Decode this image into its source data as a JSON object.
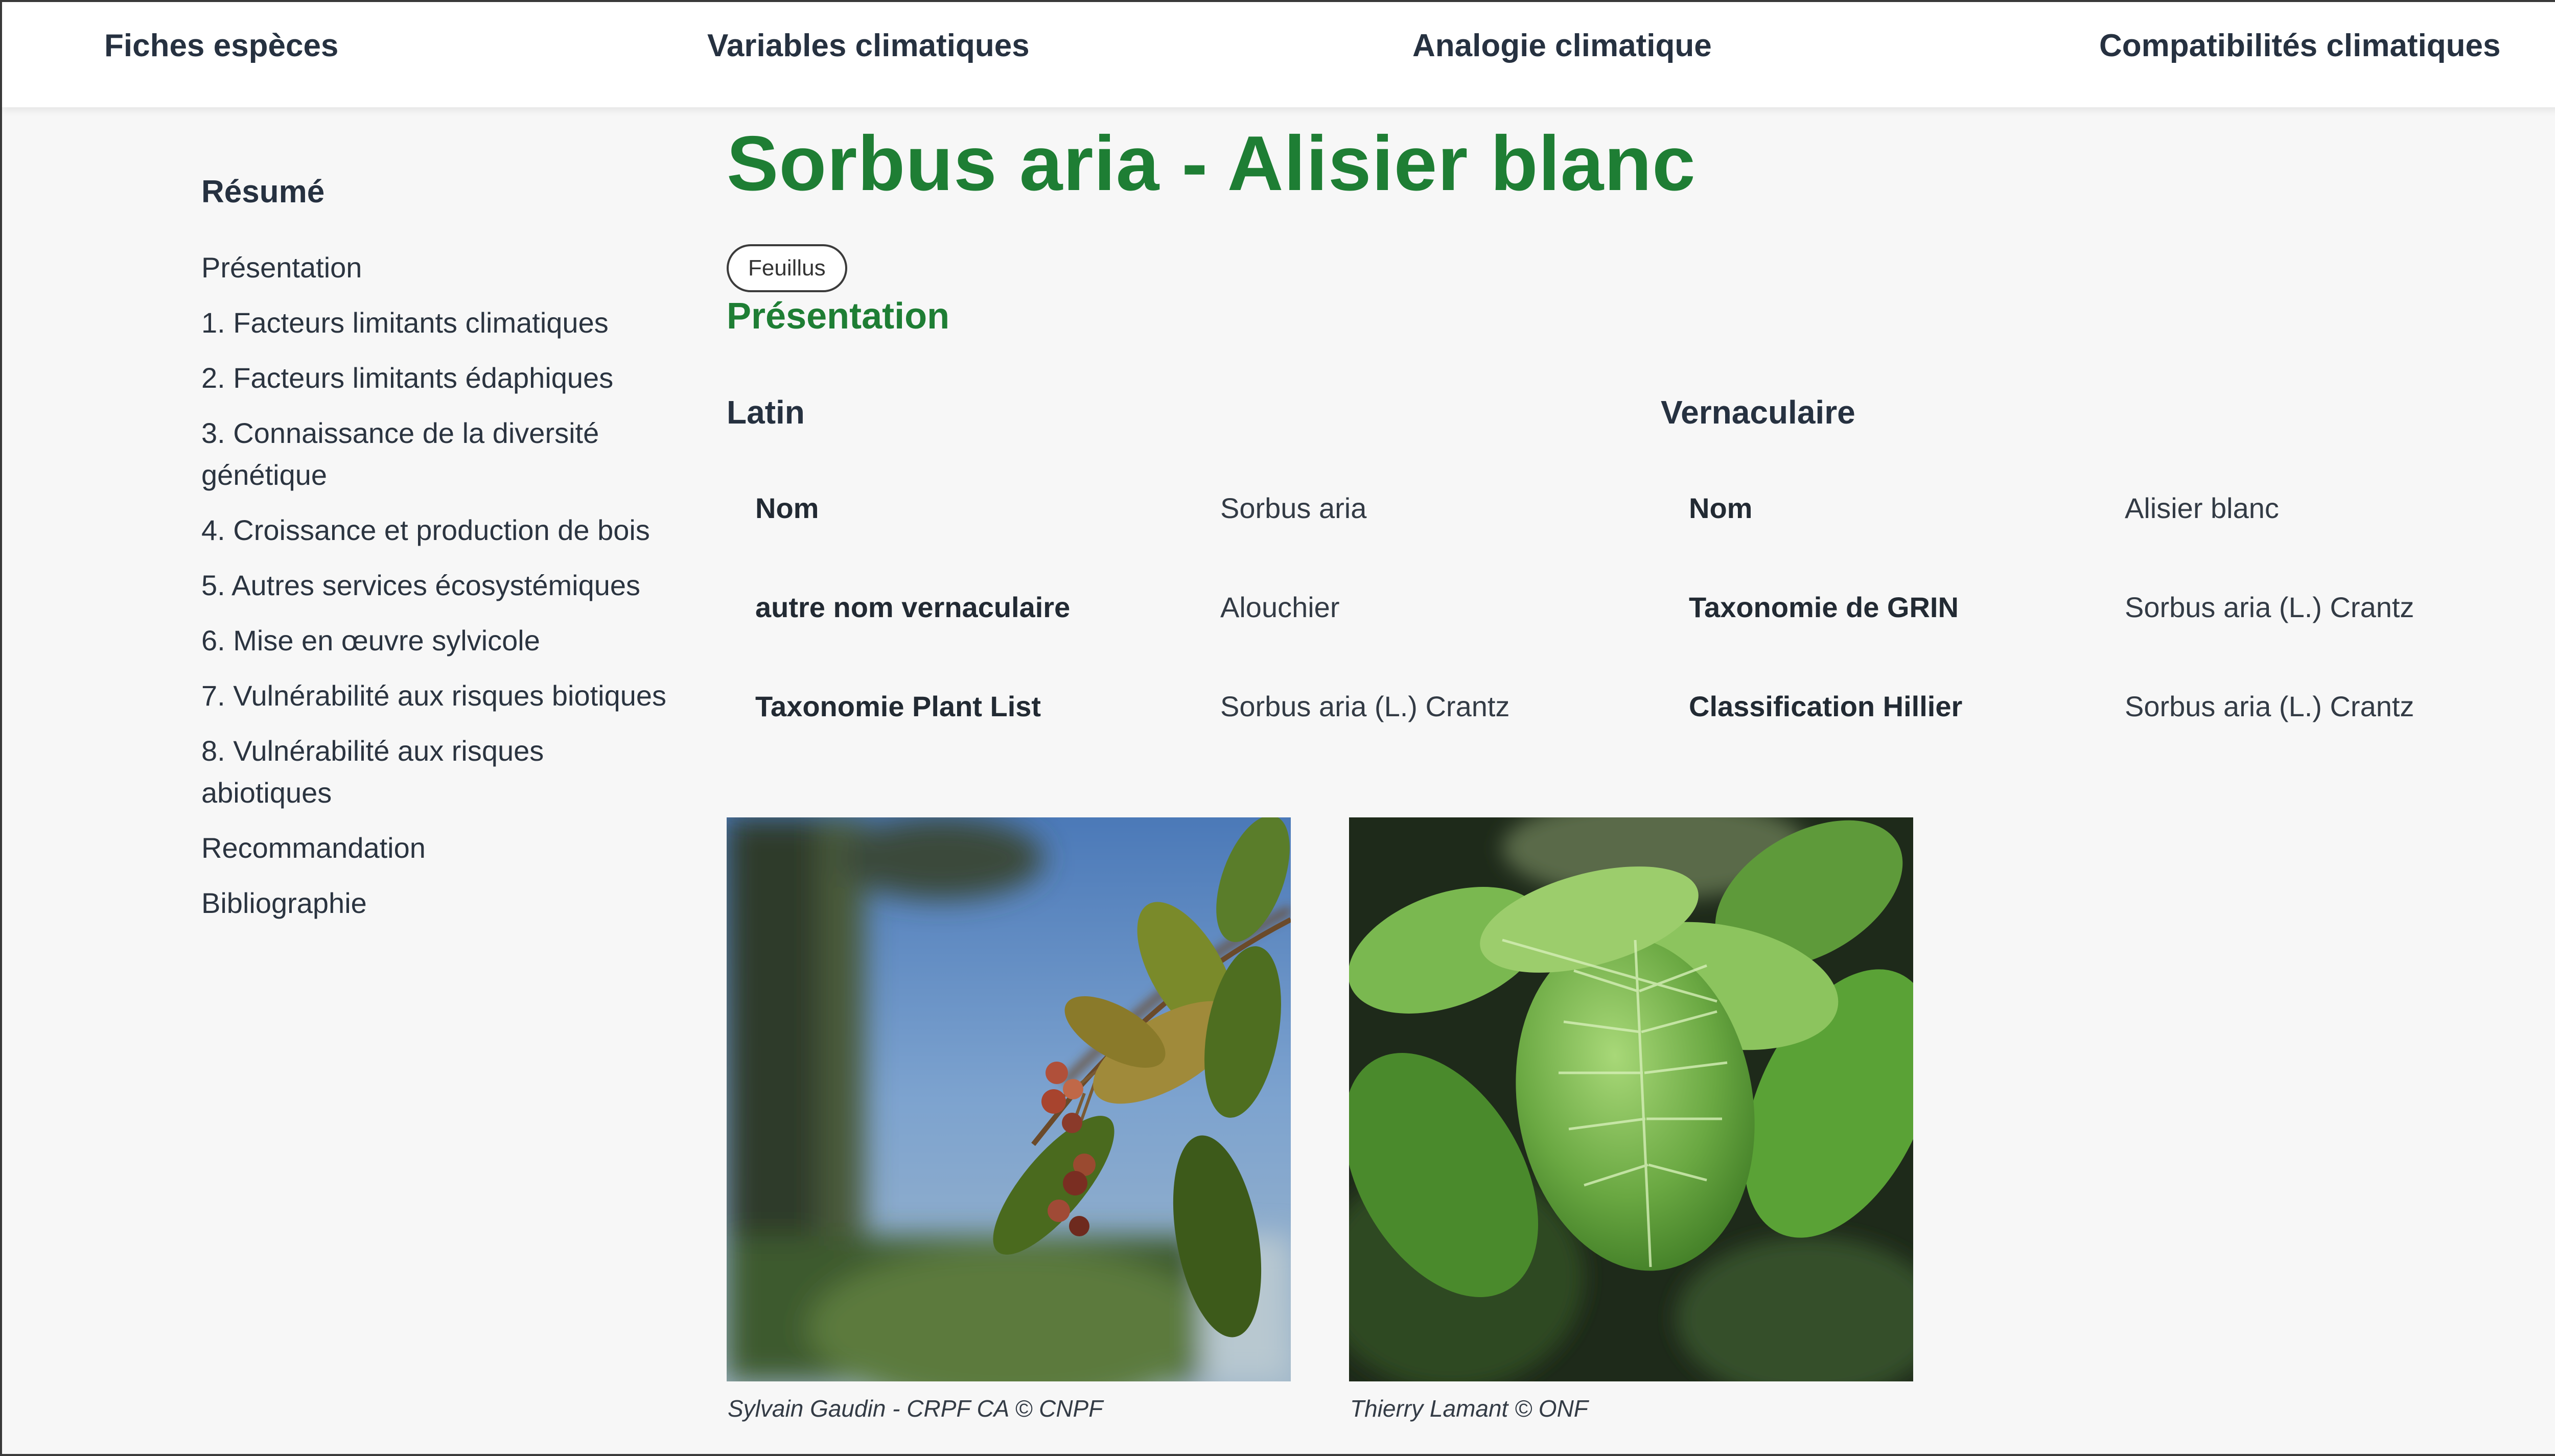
{
  "nav": {
    "items": [
      "Fiches espèces",
      "Variables climatiques",
      "Analogie climatique",
      "Compatibilités climatiques"
    ]
  },
  "sidebar": {
    "title": "Résumé",
    "items": [
      "Présentation",
      "1. Facteurs limitants climatiques",
      "2. Facteurs limitants édaphiques",
      "3. Connaissance de la diversité génétique",
      "4. Croissance et production de bois",
      "5. Autres services écosystémiques",
      "6. Mise en œuvre sylvicole",
      "7. Vulnérabilité aux risques biotiques",
      "8. Vulnérabilité aux risques abiotiques",
      "Recommandation",
      "Bibliographie"
    ]
  },
  "main": {
    "title": "Sorbus aria - Alisier blanc",
    "badge": "Feuillus",
    "section_title": "Présentation",
    "latin": {
      "heading": "Latin",
      "rows": [
        {
          "label": "Nom",
          "value": "Sorbus aria"
        },
        {
          "label": "autre nom vernaculaire",
          "value": "Alouchier"
        },
        {
          "label": "Taxonomie Plant List",
          "value": "Sorbus aria (L.) Crantz"
        }
      ]
    },
    "vernaculaire": {
      "heading": "Vernaculaire",
      "rows": [
        {
          "label": "Nom",
          "value": "Alisier blanc"
        },
        {
          "label": "Taxonomie de GRIN",
          "value": "Sorbus aria (L.) Crantz"
        },
        {
          "label": "Classification Hillier",
          "value": "Sorbus aria (L.) Crantz"
        }
      ]
    },
    "photos": [
      {
        "caption": "Sylvain Gaudin - CRPF CA © CNPF"
      },
      {
        "caption": "Thierry Lamant © ONF"
      }
    ]
  }
}
